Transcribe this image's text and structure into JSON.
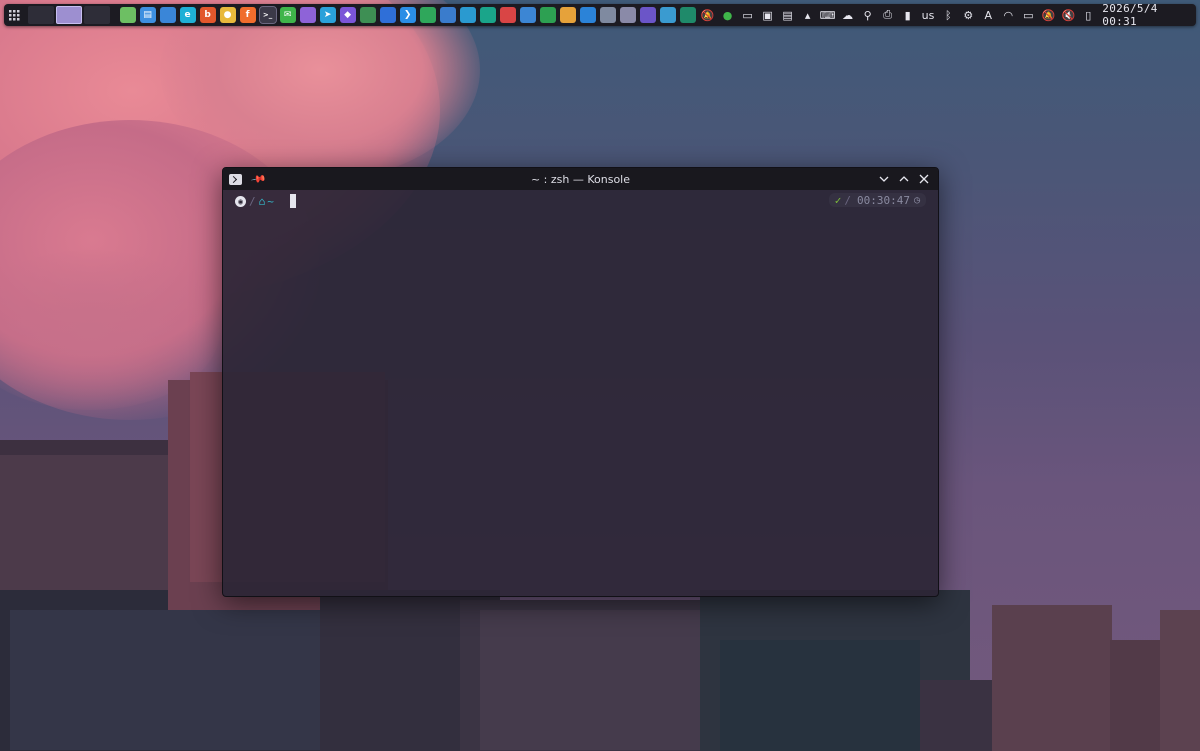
{
  "panel": {
    "launcher_icon": "app-grid-icon",
    "desktops": [
      {
        "name": "desktop-1",
        "active": false
      },
      {
        "name": "desktop-2",
        "active": true
      },
      {
        "name": "desktop-3",
        "active": false
      }
    ],
    "tasks": [
      {
        "icon": "app-icon-1",
        "color": "#6dbf63"
      },
      {
        "icon": "files-icon",
        "color": "#3d8fe0"
      },
      {
        "icon": "window-icon",
        "color": "#3a86d8"
      },
      {
        "icon": "edge-icon",
        "color": "#1fb0d6"
      },
      {
        "icon": "brave-icon",
        "color": "#e2572c"
      },
      {
        "icon": "chrome-icon",
        "color": "#e8b93c"
      },
      {
        "icon": "firefox-icon",
        "color": "#f06d2c"
      },
      {
        "icon": "konsole-icon",
        "color": "#2f2f38",
        "active": true
      },
      {
        "icon": "wechat-icon",
        "color": "#3fb54a"
      },
      {
        "icon": "app-icon-2",
        "color": "#8e63d8"
      },
      {
        "icon": "telegram-icon",
        "color": "#2aa1da"
      },
      {
        "icon": "obsidian-icon",
        "color": "#7b55d8"
      },
      {
        "icon": "app-icon-3",
        "color": "#3e8f54"
      },
      {
        "icon": "app-icon-4",
        "color": "#2f6fd8"
      },
      {
        "icon": "vscode-icon",
        "color": "#2b8ee6"
      },
      {
        "icon": "app-icon-5",
        "color": "#2fa75b"
      },
      {
        "icon": "app-icon-6",
        "color": "#3a7ccc"
      },
      {
        "icon": "app-icon-7",
        "color": "#2a9ad0"
      },
      {
        "icon": "app-icon-8",
        "color": "#1aa58a"
      },
      {
        "icon": "app-icon-9",
        "color": "#d94545"
      },
      {
        "icon": "app-icon-10",
        "color": "#3c86d4"
      },
      {
        "icon": "app-icon-11",
        "color": "#2da052"
      },
      {
        "icon": "app-icon-12",
        "color": "#e6a23a"
      },
      {
        "icon": "app-icon-13",
        "color": "#2b83d8"
      },
      {
        "icon": "app-icon-14",
        "color": "#7f8aa0"
      },
      {
        "icon": "app-icon-15",
        "color": "#8a8aa8"
      },
      {
        "icon": "app-icon-16",
        "color": "#6b55c8"
      },
      {
        "icon": "app-icon-17",
        "color": "#3a9bd0"
      },
      {
        "icon": "app-icon-18",
        "color": "#1f8a6a"
      }
    ],
    "tray": [
      "notifications-off-icon",
      "wechat-tray-icon",
      "display-icon",
      "folder-icon",
      "clipboard-icon",
      "expand-arrow-icon",
      "keyboard-icon",
      "weather-icon",
      "usb-icon",
      "printer-icon",
      "battery-icon"
    ],
    "keyboard_layout": "us",
    "tray2": [
      "bluetooth-icon",
      "settings-icon",
      "accessibility-icon",
      "wifi-icon",
      "screen-icon",
      "bell-mute-icon",
      "volume-mute-icon",
      "phone-icon"
    ],
    "clock": "2026/5/4 00:31"
  },
  "window": {
    "title": "~ : zsh — Konsole",
    "prompt": {
      "os_icon": "arch-os-icon",
      "home_icon": "home-icon",
      "dir": "~",
      "status": "✓",
      "time": "00:30:47",
      "time_icon": "clock-icon"
    }
  }
}
